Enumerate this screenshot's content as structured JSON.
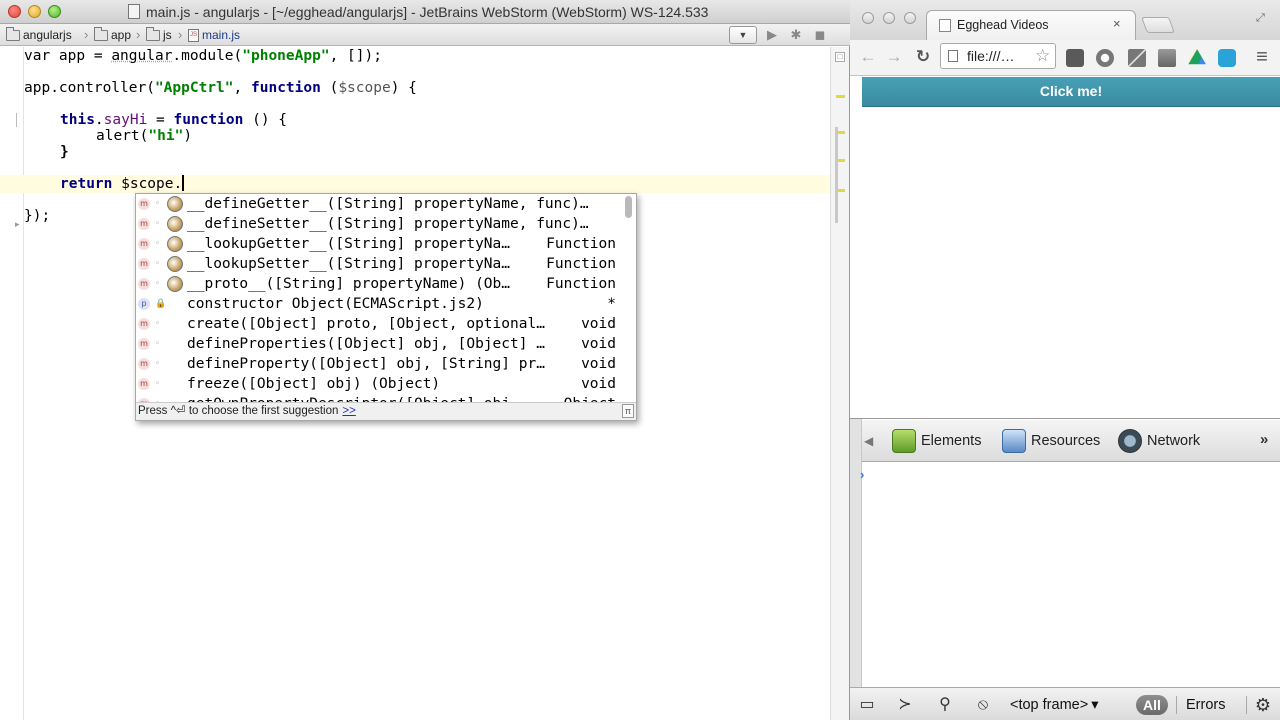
{
  "ide": {
    "title": "main.js - angularjs - [~/egghead/angularjs] - JetBrains WebStorm (WebStorm) WS-124.533",
    "breadcrumbs": [
      "angularjs",
      "app",
      "js",
      "main.js"
    ],
    "dropdown_glyph": "▼",
    "run_icon": "▶",
    "debug_icon": "✱",
    "stop_icon": "◼",
    "stripe_check": "□",
    "code": {
      "line1": {
        "kw1": "var",
        "t1": " app = ",
        "prop": "angular",
        "t2": ".module(",
        "str": "\"phoneApp\"",
        "t3": ", []);"
      },
      "line2": {
        "t1": "app.controller(",
        "str": "\"AppCtrl\"",
        "t2": ", ",
        "kw": "function",
        "t3": " (",
        "param": "$scope",
        "t4": ") {"
      },
      "line3": {
        "kw": "this",
        "t1": ".",
        "prop": "sayHi",
        "t2": " = ",
        "kw2": "function",
        "t3": " () {"
      },
      "line4": {
        "t1": "alert(",
        "str": "\"hi\"",
        "t2": ")"
      },
      "line5": {
        "t1": "}"
      },
      "line6": {
        "kw": "return",
        "t1": " $scope."
      },
      "line7": {
        "t1": "});"
      }
    },
    "completion": {
      "items": [
        {
          "kind": "m",
          "text": "__defineGetter__([String] propertyName, func)…",
          "type": ""
        },
        {
          "kind": "m",
          "text": "__defineSetter__([String] propertyName, func)…",
          "type": ""
        },
        {
          "kind": "m",
          "text": "__lookupGetter__([String] propertyNa…",
          "type": "Function"
        },
        {
          "kind": "m",
          "text": "__lookupSetter__([String] propertyNa…",
          "type": "Function"
        },
        {
          "kind": "m",
          "text": "__proto__([String] propertyName) (Ob…",
          "type": "Function"
        },
        {
          "kind": "p",
          "text": "constructor Object(ECMAScript.js2)",
          "type": "*"
        },
        {
          "kind": "m",
          "text": "create([Object] proto, [Object, optional…",
          "type": "void"
        },
        {
          "kind": "m",
          "text": "defineProperties([Object] obj, [Object] …",
          "type": "void"
        },
        {
          "kind": "m",
          "text": "defineProperty([Object] obj, [String] pr…",
          "type": "void"
        },
        {
          "kind": "m",
          "text": "freeze([Object] obj) (Object)",
          "type": "void"
        },
        {
          "kind": "m",
          "text": "getOwnPropertyDescriptor([Object] obj…",
          "type": "Object"
        }
      ],
      "footer": "Press ^⏎ to choose the first suggestion",
      "footer_link": ">>",
      "pi_glyph": "π"
    }
  },
  "browser": {
    "tab_title": "Egghead Videos",
    "tab_close": "×",
    "fullscreen_glyph": "⤢",
    "back": "←",
    "forward": "→",
    "reload": "↻",
    "address": "file:///…",
    "star": "☆",
    "page_button": "Click me!",
    "devtools": {
      "tabs": [
        "Elements",
        "Resources",
        "Network"
      ],
      "more": "»",
      "left_arrow": "◀",
      "console_prompt": "›",
      "status": {
        "dock_glyph": "▭",
        "console_glyph": "≻",
        "search_glyph": "⚲",
        "clear_glyph": "⦸",
        "frame": "<top frame>",
        "frame_arrow": "▾",
        "all": "All",
        "errors": "Errors",
        "gear_glyph": "⚙"
      }
    }
  }
}
